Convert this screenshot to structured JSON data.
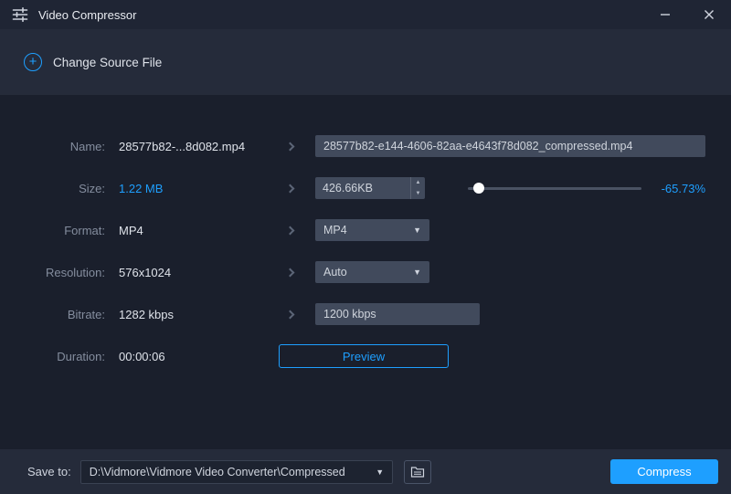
{
  "window": {
    "title": "Video Compressor"
  },
  "header": {
    "change_source_label": "Change Source File"
  },
  "fields": {
    "name": {
      "label": "Name:",
      "value": "28577b82-...8d082.mp4",
      "input": "28577b82-e144-4606-82aa-e4643f78d082_compressed.mp4"
    },
    "size": {
      "label": "Size:",
      "value": "1.22 MB",
      "input": "426.66KB",
      "percent": "-65.73%",
      "slider_position": "3%"
    },
    "format": {
      "label": "Format:",
      "value": "MP4",
      "selected": "MP4"
    },
    "resolution": {
      "label": "Resolution:",
      "value": "576x1024",
      "selected": "Auto"
    },
    "bitrate": {
      "label": "Bitrate:",
      "value": "1282 kbps",
      "input": "1200 kbps"
    },
    "duration": {
      "label": "Duration:",
      "value": "00:00:06",
      "preview_label": "Preview"
    }
  },
  "footer": {
    "save_to_label": "Save to:",
    "save_path": "D:\\Vidmore\\Vidmore Video Converter\\Compressed",
    "compress_label": "Compress"
  },
  "icons": {
    "compressor-icon": "sliders",
    "add-source-icon": "+",
    "minimize-icon": "—",
    "close-icon": "×",
    "chevron-right-icon": "❯",
    "dropdown-arrow-icon": "▼",
    "spinner-up-icon": "▲",
    "spinner-down-icon": "▼",
    "open-folder-icon": "folder"
  },
  "colors": {
    "accent": "#1e9fff",
    "slider_thumb": "#ffffff",
    "background": "#1a1f2c",
    "panel": "#252b3a"
  }
}
